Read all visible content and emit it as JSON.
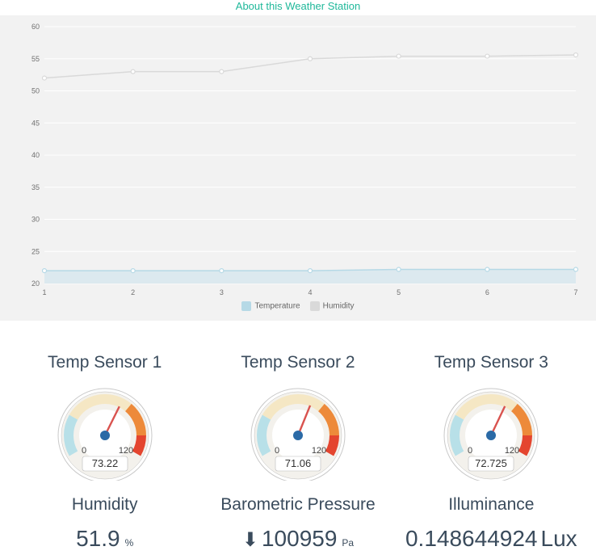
{
  "header": {
    "about_link": "About this Weather Station"
  },
  "chart_data": {
    "type": "line",
    "x": [
      1,
      2,
      3,
      4,
      5,
      6,
      7
    ],
    "series": [
      {
        "name": "Temperature",
        "values": [
          22,
          22,
          22,
          22,
          22.2,
          22.2,
          22.2
        ],
        "color": "#b6d9e6"
      },
      {
        "name": "Humidity",
        "values": [
          52,
          53,
          53,
          55,
          55.4,
          55.4,
          55.6
        ],
        "color": "#d9d9d9"
      }
    ],
    "ylim": [
      20,
      60
    ],
    "yticks": [
      20,
      25,
      30,
      35,
      40,
      45,
      50,
      55,
      60
    ],
    "xlabel": "",
    "ylabel": "",
    "title": ""
  },
  "legend": {
    "temperature": "Temperature",
    "humidity": "Humidity"
  },
  "sensors": {
    "temp1": {
      "title": "Temp Sensor 1",
      "min": 0,
      "max": 120,
      "value": 73.22,
      "value_str": "73.22"
    },
    "temp2": {
      "title": "Temp Sensor 2",
      "min": 0,
      "max": 120,
      "value": 71.06,
      "value_str": "71.06"
    },
    "temp3": {
      "title": "Temp Sensor 3",
      "min": 0,
      "max": 120,
      "value": 72.725,
      "value_str": "72.725"
    }
  },
  "readouts": {
    "humidity": {
      "title": "Humidity",
      "value": "51.9",
      "unit": "%"
    },
    "pressure": {
      "title": "Barometric Pressure",
      "value": "100959",
      "unit": "Pa",
      "trend": "down"
    },
    "illuminance": {
      "title": "Illuminance",
      "value": "0.148644924",
      "unit": "Lux"
    }
  }
}
